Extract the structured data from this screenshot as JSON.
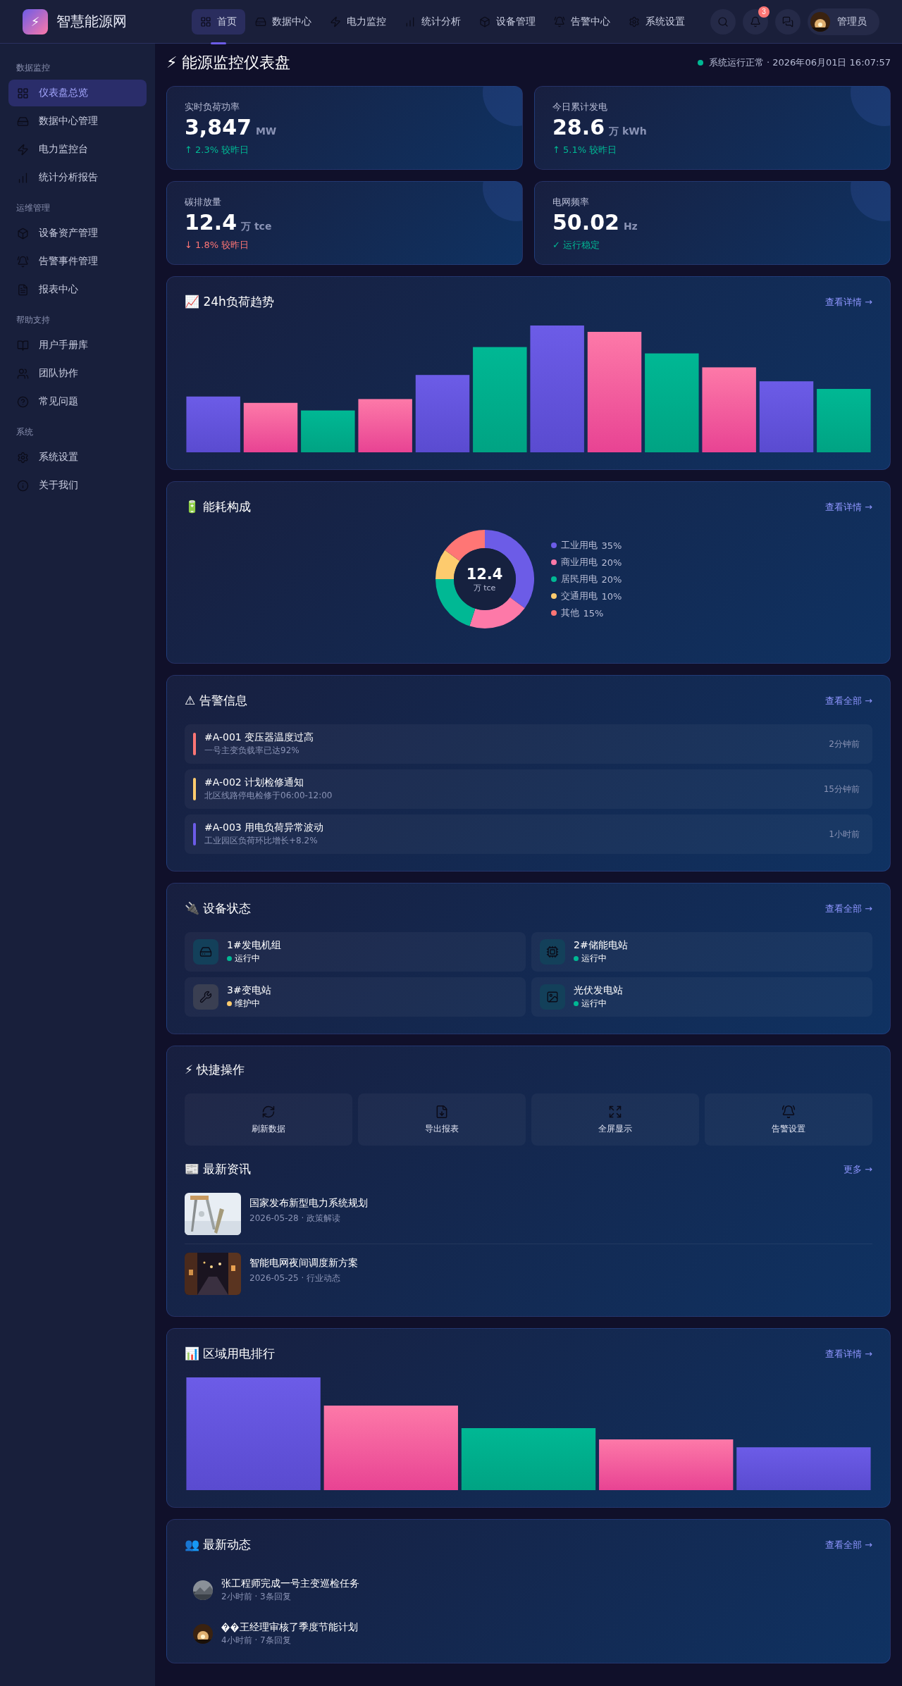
{
  "header": {
    "logo": "⚡",
    "brand": "智慧能源网",
    "nav": [
      {
        "label": "首页",
        "selected": true
      },
      {
        "label": "数据中心",
        "selected": false
      },
      {
        "label": "电力监控",
        "selected": false
      },
      {
        "label": "统计分析",
        "selected": false
      },
      {
        "label": "设备管理",
        "selected": false
      },
      {
        "label": "告警中心",
        "selected": false
      },
      {
        "label": "系统设置",
        "selected": false
      }
    ],
    "badge": "3",
    "user": "管理员"
  },
  "sidebar": {
    "sections": [
      {
        "title": "数据监控",
        "items": [
          {
            "label": "仪表盘总览",
            "selected": true
          },
          {
            "label": "数据中心管理",
            "selected": false
          },
          {
            "label": "电力监控台",
            "selected": false
          },
          {
            "label": "统计分析报告",
            "selected": false
          }
        ]
      },
      {
        "title": "运维管理",
        "items": [
          {
            "label": "设备资产管理",
            "selected": false
          },
          {
            "label": "告警事件管理",
            "selected": false
          },
          {
            "label": "报表中心",
            "selected": false
          }
        ]
      },
      {
        "title": "帮助支持",
        "items": [
          {
            "label": "用户手册库",
            "selected": false
          },
          {
            "label": "团队协作",
            "selected": false
          },
          {
            "label": "常见问题",
            "selected": false
          }
        ]
      },
      {
        "title": "系统",
        "items": [
          {
            "label": "系统设置",
            "selected": false
          },
          {
            "label": "关于我们",
            "selected": false
          }
        ]
      }
    ]
  },
  "page": {
    "title": "⚡ 能源监控仪表盘",
    "status": "系统运行正常 · 2026年06月01日 16:07:57"
  },
  "stats": [
    {
      "label": "实时负荷功率",
      "value": "3,847",
      "unit": "MW",
      "change": "↑ 2.3% 较昨日",
      "kind": "up"
    },
    {
      "label": "今日累计发电",
      "value": "28.6",
      "unit": "万 kWh",
      "change": "↑ 5.1% 较昨日",
      "kind": "up"
    },
    {
      "label": "碳排放量",
      "value": "12.4",
      "unit": "万 tce",
      "change": "↓ 1.8% 较昨日",
      "kind": "down"
    },
    {
      "label": "电网频率",
      "value": "50.02",
      "unit": "Hz",
      "change": "✓ 运行稳定",
      "kind": "ok"
    }
  ],
  "load_chart": {
    "title": "📈 24h负荷趋势",
    "link": "查看详情 →"
  },
  "energy_mix": {
    "title": "🔋 能耗构成",
    "link": "查看详情 →",
    "center_value": "12.4",
    "center_unit": "万 tce",
    "legend": [
      {
        "color": "#6c5ce7"
      },
      {
        "color": "#fd79a8"
      },
      {
        "color": "#00b894"
      },
      {
        "color": "#fdcb6e"
      },
      {
        "color": "#ff7675"
      }
    ],
    "chart_data": {
      "type": "donut",
      "categories": [
        "工业用电",
        "商业用电",
        "居民用电",
        "交通用电",
        "其他"
      ],
      "values": [
        35,
        20,
        20,
        10,
        15
      ],
      "value_labels": [
        "35%",
        "20%",
        "20%",
        "10%",
        "15%"
      ]
    }
  },
  "alerts": {
    "title": "⚠ 告警信息",
    "link": "查看全部 →",
    "items": [
      {
        "title": "#A-001 变压器温度过高",
        "detail": "一号主变负载率已达92%",
        "time": "2分钟前",
        "color": "#ff7675"
      },
      {
        "title": "#A-002 计划检修通知",
        "detail": "北区线路停电检修于06:00-12:00",
        "time": "15分钟前",
        "color": "#fdcb6e"
      },
      {
        "title": "#A-003 用电负荷异常波动",
        "detail": "工业园区负荷环比增长+8.2%",
        "time": "1小时前",
        "color": "#6c5ce7"
      }
    ]
  },
  "devices": {
    "title": "🔌 设备状态",
    "link": "查看全部 →",
    "items": [
      {
        "name": "1#发电机组",
        "status": "运行中",
        "color": "#00b894"
      },
      {
        "name": "2#储能电站",
        "status": "运行中",
        "color": "#00b894"
      },
      {
        "name": "3#变电站",
        "status": "维护中",
        "color": "#fdcb6e"
      },
      {
        "name": "光伏发电站",
        "status": "运行中",
        "color": "#00b894"
      }
    ]
  },
  "quick": {
    "title": "⚡ 快捷操作",
    "actions": [
      "刷新数据",
      "导出报表",
      "全屏显示",
      "告警设置"
    ]
  },
  "news": {
    "title": "📰 最新资讯",
    "link": "更多 →",
    "items": [
      {
        "title": "国家发布新型电力系统规划",
        "meta": "2026-05-28 · 政策解读"
      },
      {
        "title": "智能电网夜间调度新方案",
        "meta": "2026-05-25 · 行业动态"
      }
    ]
  },
  "region_chart": {
    "title": "📊 区域用电排行",
    "link": "查看详情 →"
  },
  "activity": {
    "title": "👥 最新动态",
    "link": "查看全部 →",
    "items": [
      {
        "text": "张工程师完成一号主变巡检任务",
        "meta": "2小时前 · 3条回复",
        "kind": "plain"
      },
      {
        "text": "王经理审核了季度节能计划",
        "meta": "4小时前 · 7条回复",
        "kind": "garbled"
      }
    ]
  }
}
